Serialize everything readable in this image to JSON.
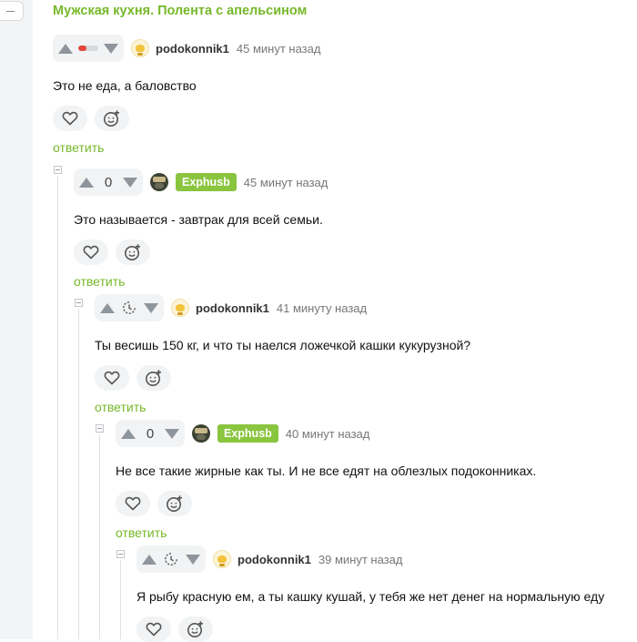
{
  "thread_title": "Мужская кухня. Полента с апельсином",
  "reply_label": "ответить",
  "comments": [
    {
      "vote_display": "rating-bar",
      "rating_fraction": 0.4,
      "rating_color": "#e2463c",
      "vote_count": "",
      "avatar": "crown-avatar",
      "username": "podokonnik1",
      "username_style": "plain",
      "timestamp": "45 минут назад",
      "text": "Это не еда, а баловство"
    },
    {
      "vote_display": "number",
      "vote_count": "0",
      "avatar": "photo-avatar",
      "username": "Exphusb",
      "username_style": "green-badge",
      "timestamp": "45 минут назад",
      "text": "Это называется - завтрак для всей семьи."
    },
    {
      "vote_display": "clock-icon",
      "vote_count": "",
      "avatar": "crown-avatar",
      "username": "podokonnik1",
      "username_style": "plain",
      "timestamp": "41 минуту назад",
      "text": "Ты весишь 150 кг, и что ты наелся ложечкой кашки кукурузной?"
    },
    {
      "vote_display": "number",
      "vote_count": "0",
      "avatar": "photo-avatar",
      "username": "Exphusb",
      "username_style": "green-badge",
      "timestamp": "40 минут назад",
      "text": "Не все такие жирные как ты. И не все едят на облезлых подоконниках."
    },
    {
      "vote_display": "clock-icon",
      "vote_count": "",
      "avatar": "crown-avatar",
      "username": "podokonnik1",
      "username_style": "plain",
      "timestamp": "39 минут назад",
      "text": "Я рыбу красную ем, а ты кашку кушай, у тебя же нет денег на нормальную еду"
    }
  ],
  "colors": {
    "accent_green": "#76b82a",
    "badge_green": "#8ac53f",
    "icon_gray": "#8f959c"
  },
  "icons": {
    "upvote": "triangle-up-icon",
    "downvote": "triangle-down-icon",
    "like": "heart-icon",
    "react": "smiley-plus-icon",
    "collapse": "minus-square-icon",
    "pending_rating": "clock-icon"
  }
}
